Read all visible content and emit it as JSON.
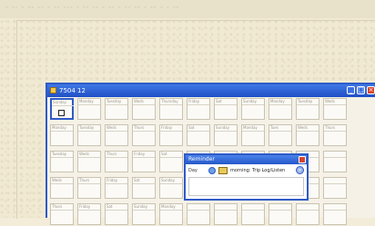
{
  "desktop": {
    "top_text": "· ·· · ·· ·· · ·· ··· · ·· ·· · ·· · ·· ·· · ·· · · ··"
  },
  "window": {
    "title": "7504 12",
    "min_glyph": "_",
    "max_glyph": "□",
    "close_glyph": "×",
    "rows": [
      [
        "Sunday",
        "Monday",
        "Tuesday",
        "Weds",
        "Thursday",
        "Friday",
        "Sat",
        "Sunday",
        "Monday",
        "Tuesday",
        "Weds"
      ],
      [
        "Monday",
        "Tuesday",
        "Weds",
        "Thurs",
        "Friday",
        "Sat",
        "Sunday",
        "Monday",
        "Tues",
        "Weds",
        "Thurs"
      ],
      [
        "Tuesday",
        "Weds",
        "Thurs",
        "Friday",
        "Sat",
        "",
        "",
        "",
        "",
        "",
        ""
      ],
      [
        "Weds",
        "Thurs",
        "Friday",
        "Sat",
        "Sunday",
        "",
        "",
        "",
        "",
        "",
        ""
      ],
      [
        "Thurs",
        "Friday",
        "Sat",
        "Sunday",
        "Monday",
        "",
        "",
        "",
        "",
        "",
        ""
      ]
    ]
  },
  "popup": {
    "title": "Reminder",
    "label": "Day",
    "text": "morning: Trip Log/Listen",
    "arrow": "»"
  },
  "colors": {
    "accent": "#2f5bc8",
    "titlebar": "#1f4fc4",
    "close": "#d9442b",
    "desktop": "#f1ead3"
  }
}
